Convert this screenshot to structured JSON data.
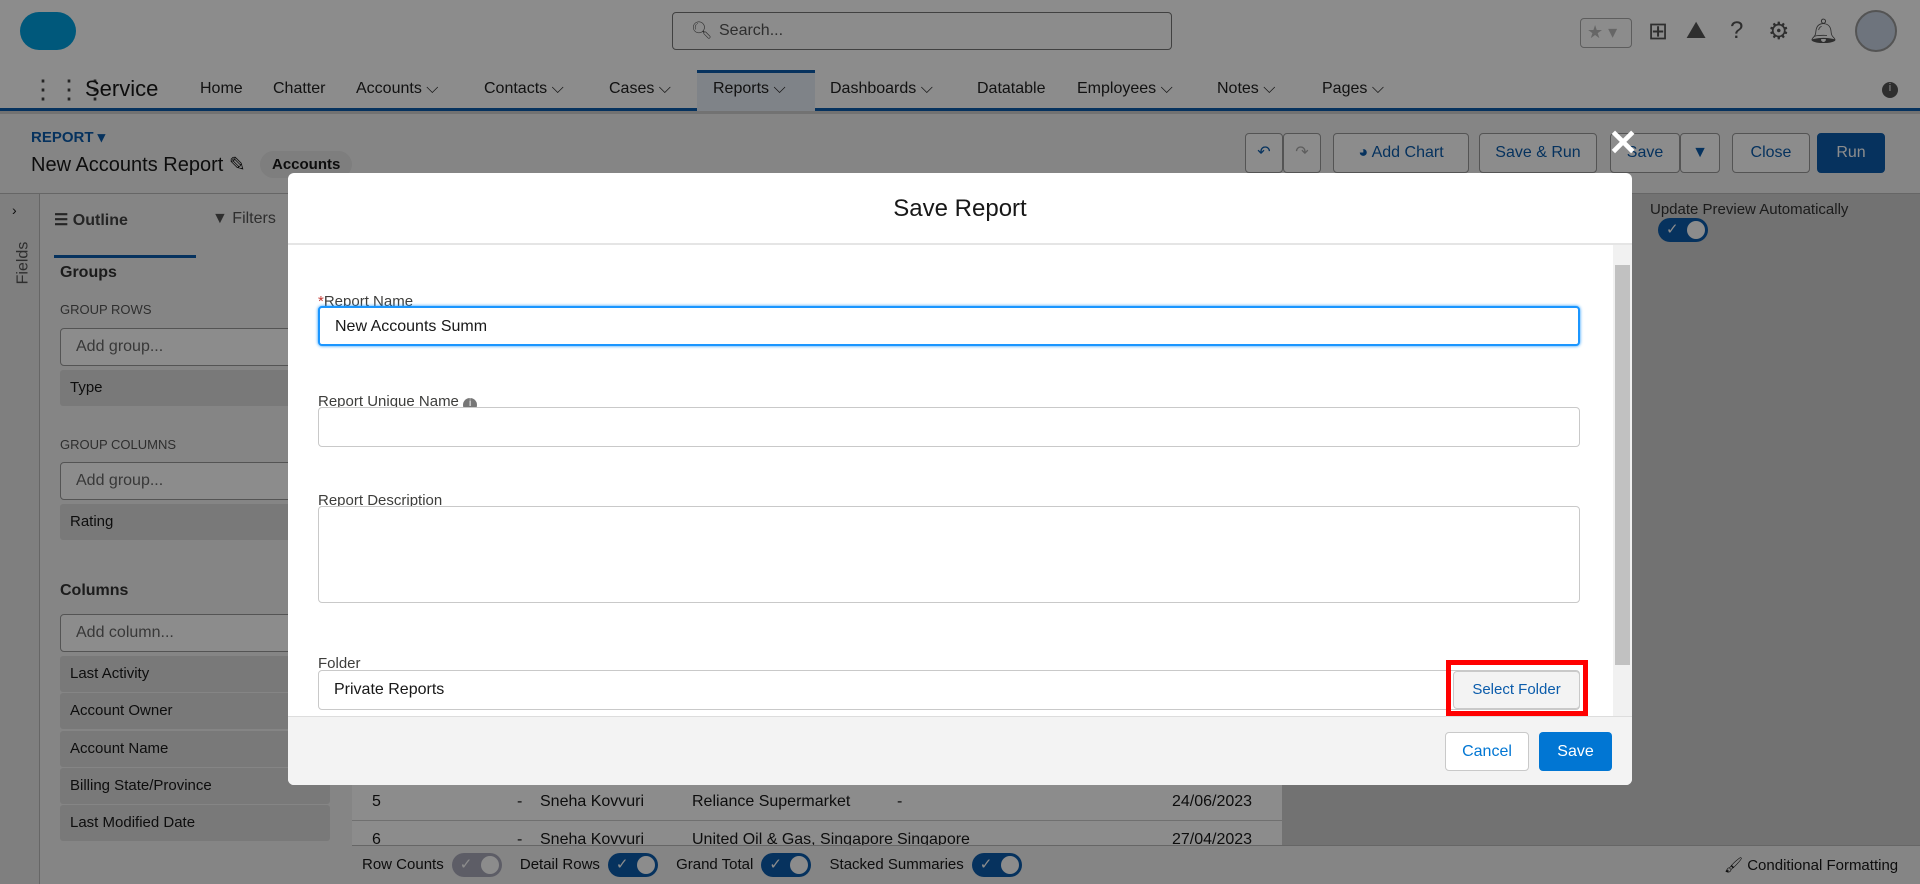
{
  "header": {
    "search_placeholder": "Search...",
    "app_name": "Service"
  },
  "nav": [
    "Home",
    "Chatter",
    "Accounts",
    "Contacts",
    "Cases",
    "Reports",
    "Dashboards",
    "Datatable",
    "Employees",
    "Notes",
    "Pages"
  ],
  "report": {
    "type_label": "REPORT",
    "title": "New Accounts Report",
    "object_badge": "Accounts"
  },
  "toolbar": {
    "add_chart": "Add Chart",
    "save_run": "Save & Run",
    "save": "Save",
    "close": "Close",
    "run": "Run"
  },
  "update_preview": "Update Preview Automatically",
  "left": {
    "fields_tab": "Fields",
    "outline_tab": "Outline",
    "filters_tab": "Filters",
    "groups": "Groups",
    "group_rows": "GROUP ROWS",
    "add_group": "Add group...",
    "group_row_items": [
      "Type"
    ],
    "group_columns": "GROUP COLUMNS",
    "group_col_items": [
      "Rating"
    ],
    "columns": "Columns",
    "add_column": "Add column...",
    "column_items": [
      "Last Activity",
      "Account Owner",
      "Account Name",
      "Billing State/Province",
      "Last Modified Date"
    ]
  },
  "table": {
    "rows": [
      [
        "5",
        "-",
        "Sneha Kovvuri",
        "Reliance Supermarket",
        "-",
        "24/06/2023"
      ],
      [
        "6",
        "-",
        "Sneha Kovvuri",
        "United Oil & Gas, Singapore",
        "Singapore",
        "27/04/2023"
      ]
    ]
  },
  "footer": {
    "row_counts": "Row Counts",
    "detail_rows": "Detail Rows",
    "grand_total": "Grand Total",
    "stacked": "Stacked Summaries",
    "conditional": "Conditional Formatting"
  },
  "modal": {
    "title": "Save Report",
    "name_label": "Report Name",
    "name_value": "New Accounts Summ",
    "unique_label": "Report Unique Name",
    "unique_value": "",
    "desc_label": "Report Description",
    "desc_value": "",
    "folder_label": "Folder",
    "folder_value": "Private Reports",
    "select_folder": "Select Folder",
    "cancel": "Cancel",
    "save": "Save"
  },
  "colors": {
    "brand": "#0b5cab",
    "save_button": "#0176d3",
    "highlight": "#ff0000"
  }
}
